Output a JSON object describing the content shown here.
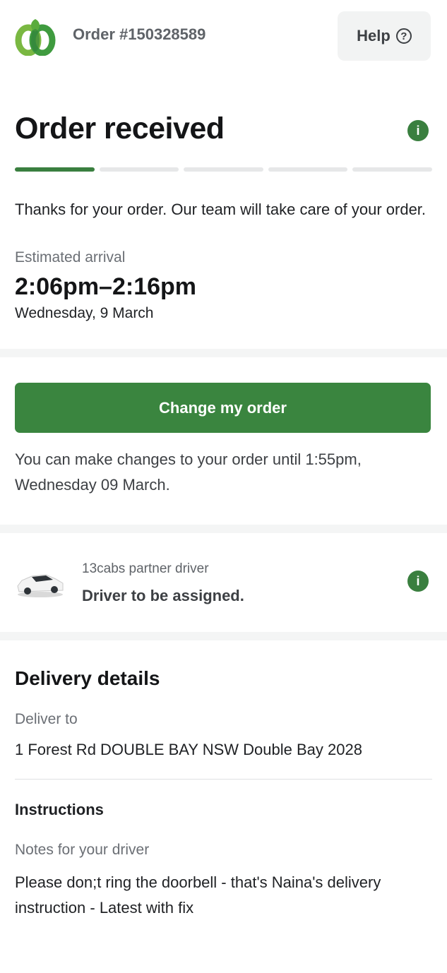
{
  "header": {
    "order_number": "Order #150328589",
    "help_label": "Help",
    "help_icon": "question-circle-icon"
  },
  "status": {
    "title": "Order received",
    "progress_steps": 5,
    "progress_active": 1,
    "message": "Thanks for your order. Our team will take care of your order.",
    "arrival_label": "Estimated arrival",
    "arrival_time": "2:06pm–2:16pm",
    "arrival_date": "Wednesday, 9 March"
  },
  "change_order": {
    "button_label": "Change my order",
    "note": "You can make changes to your order until 1:55pm, Wednesday 09 March."
  },
  "driver": {
    "partner_label": "13cabs partner driver",
    "status": "Driver to be assigned."
  },
  "delivery": {
    "heading": "Delivery details",
    "deliver_to_label": "Deliver to",
    "address": "1 Forest Rd DOUBLE BAY NSW Double Bay 2028",
    "instructions_heading": "Instructions",
    "notes_label": "Notes for your driver",
    "notes": "Please don;t ring the doorbell - that's Naina's delivery instruction - Latest with fix"
  },
  "colors": {
    "brand_green": "#3a853f",
    "light_grey": "#f2f3f3"
  }
}
